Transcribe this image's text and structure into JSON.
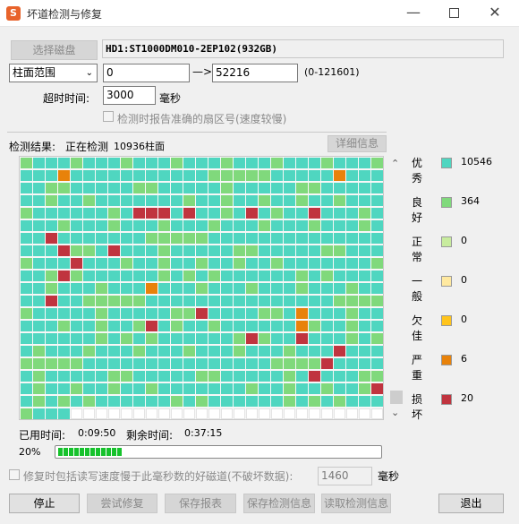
{
  "window": {
    "title": "坏道检测与修复",
    "app_icon": "S"
  },
  "top": {
    "select_disk_label": "选择磁盘",
    "disk_info": "HD1:ST1000DM010-2EP102(932GB)",
    "range_type": "柱面范围",
    "range_start": "0",
    "arrow": "—>",
    "range_end": "52216",
    "range_limits": "(0-121601)",
    "timeout_label": "超时时间:",
    "timeout_value": "3000",
    "timeout_unit": "毫秒",
    "report_sector_label": "检测时报告准确的扇区号(速度较慢)"
  },
  "status": {
    "result_label": "检测结果:",
    "result_value": "正在检测",
    "cylinder_count": "10936柱面",
    "detail_button": "详细信息"
  },
  "legend": [
    {
      "label": "优秀",
      "count": "10546",
      "color": "#4fd6c0"
    },
    {
      "label": "良好",
      "count": "364",
      "color": "#80d97c"
    },
    {
      "label": "正常",
      "count": "0",
      "color": "#c8ec9e"
    },
    {
      "label": "一般",
      "count": "0",
      "color": "#ffe9a0"
    },
    {
      "label": "欠佳",
      "count": "0",
      "color": "#ffc41c"
    },
    {
      "label": "严重",
      "count": "6",
      "color": "#e8820a"
    },
    {
      "label": "损坏",
      "count": "20",
      "color": "#c0343f"
    }
  ],
  "time": {
    "used_label": "已用时间:",
    "used_value": "0:09:50",
    "remaining_label": "剩余时间:",
    "remaining_value": "0:37:15"
  },
  "progress": {
    "percent_text": "20%",
    "fraction": 0.2
  },
  "repair": {
    "option_label": "修复时包括读写速度慢于此毫秒数的好磁道(不破坏数据):",
    "threshold_value": "1460",
    "threshold_unit": "毫秒"
  },
  "buttons": {
    "stop": "停止",
    "try_repair": "尝试修复",
    "save_report": "保存报表",
    "save_scan": "保存检测信息",
    "load_scan": "读取检测信息",
    "exit": "退出"
  }
}
